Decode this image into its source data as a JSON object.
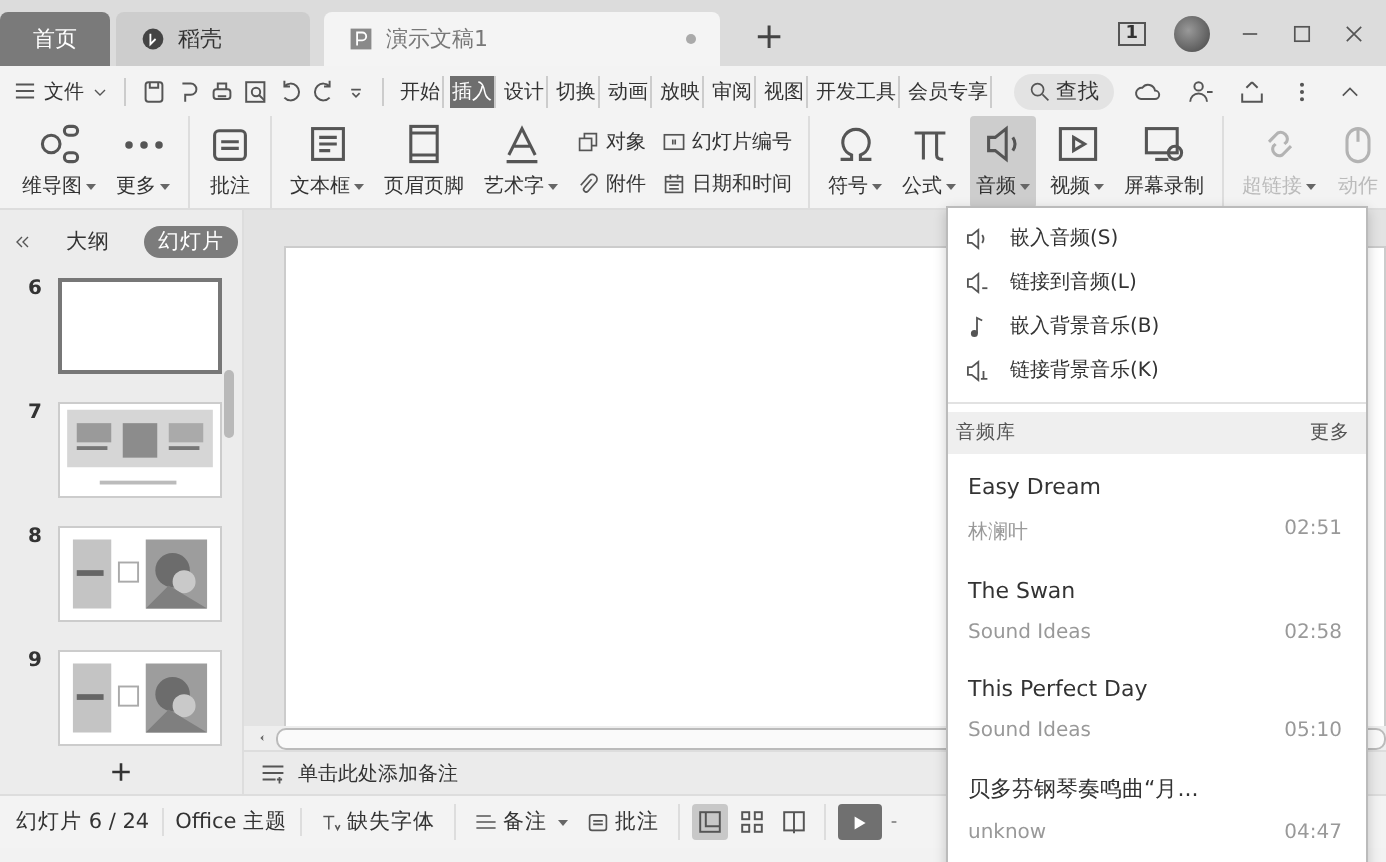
{
  "tabs": [
    {
      "label": "首页",
      "kind": "home",
      "selected": false
    },
    {
      "label": "稻壳",
      "kind": "app",
      "selected": false
    },
    {
      "label": "演示文稿1",
      "kind": "doc",
      "selected": true
    }
  ],
  "new_tab": "+",
  "window_controls": {
    "window_count": "1"
  },
  "menu": {
    "file_label": "文件",
    "items": [
      {
        "label": "开始",
        "selected": false
      },
      {
        "label": "插入",
        "selected": true
      },
      {
        "label": "设计",
        "selected": false
      },
      {
        "label": "切换",
        "selected": false
      },
      {
        "label": "动画",
        "selected": false
      },
      {
        "label": "放映",
        "selected": false
      },
      {
        "label": "审阅",
        "selected": false
      },
      {
        "label": "视图",
        "selected": false
      },
      {
        "label": "开发工具",
        "selected": false
      },
      {
        "label": "会员专享",
        "selected": false
      }
    ],
    "search_label": "查找"
  },
  "ribbon_groups": [
    [
      {
        "kind": "large",
        "label": "维导图",
        "dropdown": true,
        "pressed": false,
        "disabled": false
      },
      {
        "kind": "large",
        "label": "更多",
        "dropdown": true,
        "pressed": false,
        "disabled": false
      }
    ],
    [
      {
        "kind": "large",
        "label": "批注",
        "dropdown": false,
        "pressed": false,
        "disabled": false
      }
    ],
    [
      {
        "kind": "large",
        "label": "文本框",
        "dropdown": true,
        "pressed": false,
        "disabled": false
      },
      {
        "kind": "large",
        "label": "页眉页脚",
        "dropdown": false,
        "pressed": false,
        "disabled": false
      },
      {
        "kind": "large",
        "label": "艺术字",
        "dropdown": true,
        "pressed": false,
        "disabled": false
      },
      {
        "kind": "pair",
        "items": [
          {
            "label": "对象"
          },
          {
            "label": "附件"
          }
        ]
      },
      {
        "kind": "pair",
        "items": [
          {
            "label": "幻灯片编号"
          },
          {
            "label": "日期和时间"
          }
        ]
      }
    ],
    [
      {
        "kind": "large",
        "label": "符号",
        "dropdown": true,
        "pressed": false,
        "disabled": false
      },
      {
        "kind": "large",
        "label": "公式",
        "dropdown": true,
        "pressed": false,
        "disabled": false
      },
      {
        "kind": "large",
        "label": "音频",
        "dropdown": true,
        "pressed": true,
        "disabled": false
      },
      {
        "kind": "large",
        "label": "视频",
        "dropdown": true,
        "pressed": false,
        "disabled": false
      },
      {
        "kind": "large",
        "label": "屏幕录制",
        "dropdown": false,
        "pressed": false,
        "disabled": false
      }
    ],
    [
      {
        "kind": "large",
        "label": "超链接",
        "dropdown": true,
        "pressed": false,
        "disabled": true
      },
      {
        "kind": "large",
        "label": "动作",
        "dropdown": false,
        "pressed": false,
        "disabled": true
      }
    ]
  ],
  "sidebar": {
    "tabs": [
      {
        "label": "大纲",
        "selected": false
      },
      {
        "label": "幻灯片",
        "selected": true
      }
    ],
    "slides": [
      {
        "number": "6",
        "kind": "blank",
        "selected": true
      },
      {
        "number": "7",
        "kind": "three-photos",
        "selected": false
      },
      {
        "number": "8",
        "kind": "photo-right",
        "selected": false
      },
      {
        "number": "9",
        "kind": "photo-right",
        "selected": false
      }
    ]
  },
  "add_slide": "+",
  "notes_placeholder": "单击此处添加备注",
  "audio_menu": {
    "items": [
      {
        "label": "嵌入音频(S)"
      },
      {
        "label": "链接到音频(L)"
      },
      {
        "label": "嵌入背景音乐(B)"
      },
      {
        "label": "链接背景音乐(K)"
      }
    ],
    "library_title": "音频库",
    "library_more": "更多",
    "songs": [
      {
        "title": "Easy Dream",
        "artist": "林澜叶",
        "duration": "02:51"
      },
      {
        "title": "The Swan",
        "artist": "Sound Ideas",
        "duration": "02:58"
      },
      {
        "title": "This Perfect Day",
        "artist": "Sound Ideas",
        "duration": "05:10"
      },
      {
        "title": "贝多芬钢琴奏鸣曲“月...",
        "artist": "unknow",
        "duration": "04:47"
      }
    ]
  },
  "status_bar": {
    "slide_counter": "幻灯片 6 / 24",
    "theme": "Office 主题",
    "missing_fonts": "缺失字体",
    "notes": "备注",
    "comments": "批注",
    "views": [
      {
        "kind": "normal",
        "selected": true
      },
      {
        "kind": "sorter",
        "selected": false
      },
      {
        "kind": "reading",
        "selected": false
      }
    ]
  }
}
